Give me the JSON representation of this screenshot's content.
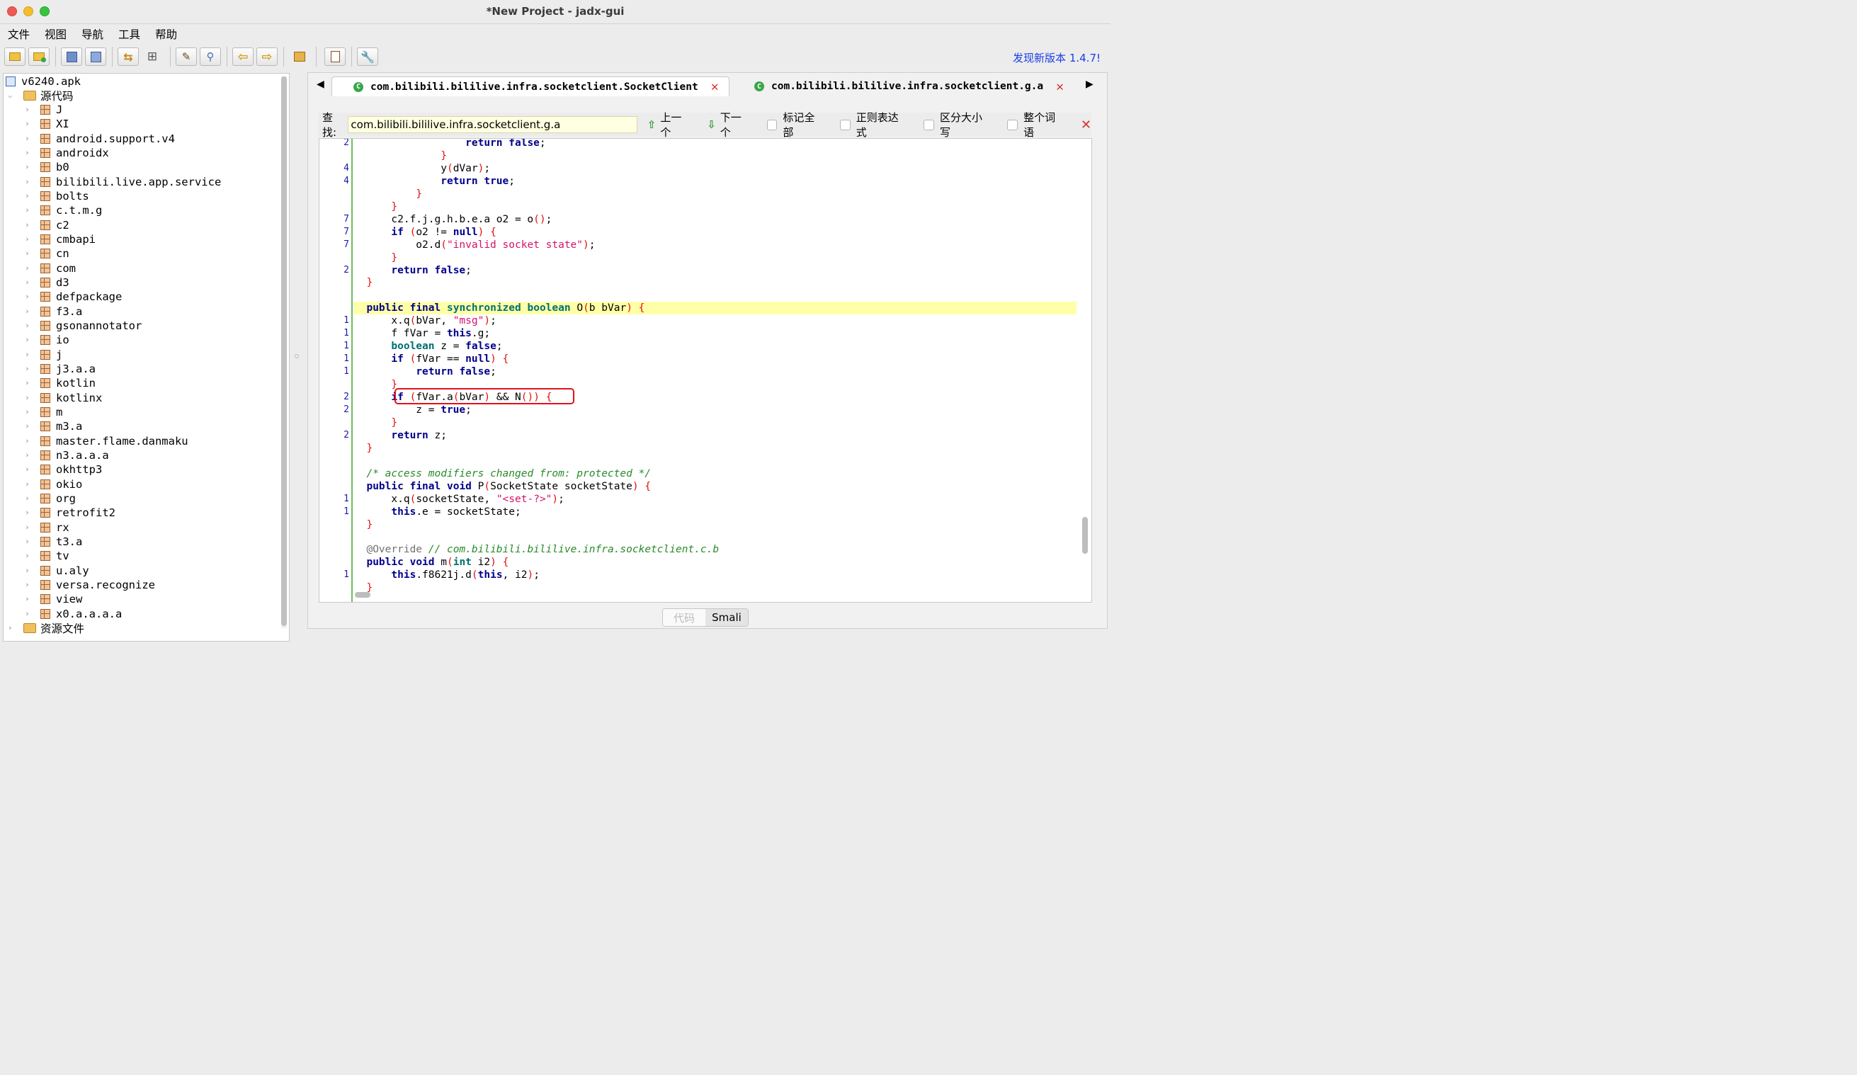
{
  "window": {
    "title": "*New Project - jadx-gui"
  },
  "menu": [
    "文件",
    "视图",
    "导航",
    "工具",
    "帮助"
  ],
  "toolbar": {
    "update_notice": "发现新版本 1.4.7!"
  },
  "tree": {
    "root": "v6240.apk",
    "source_folder": "源代码",
    "packages": [
      "J",
      "XI",
      "android.support.v4",
      "androidx",
      "b0",
      "bilibili.live.app.service",
      "bolts",
      "c.t.m.g",
      "c2",
      "cmbapi",
      "cn",
      "com",
      "d3",
      "defpackage",
      "f3.a",
      "gsonannotator",
      "io",
      "j",
      "j3.a.a",
      "kotlin",
      "kotlinx",
      "m",
      "m3.a",
      "master.flame.danmaku",
      "n3.a.a.a",
      "okhttp3",
      "okio",
      "org",
      "retrofit2",
      "rx",
      "t3.a",
      "tv",
      "u.aly",
      "versa.recognize",
      "view",
      "x0.a.a.a.a"
    ],
    "resources_folder": "资源文件"
  },
  "tabs": [
    {
      "label": "com.bilibili.bililive.infra.socketclient.SocketClient",
      "active": true
    },
    {
      "label": "com.bilibili.bililive.infra.socketclient.g.a",
      "active": false
    }
  ],
  "search": {
    "label": "查找:",
    "value": "com.bilibili.bililive.infra.socketclient.g.a",
    "prev": "上一个",
    "next": "下一个",
    "mark_all": "标记全部",
    "regex": "正则表达式",
    "case_sensitive": "区分大小写",
    "whole_word": "整个词语"
  },
  "code_lines": [
    {
      "n": "2",
      "html": "                <span class=\"kw\">return</span> <span class=\"kw\">false</span>;"
    },
    {
      "n": "",
      "html": "            <span class=\"br\">}</span>"
    },
    {
      "n": "4",
      "html": "            y<span class=\"br\">(</span>dVar<span class=\"br\">)</span>;"
    },
    {
      "n": "4",
      "html": "            <span class=\"kw\">return</span> <span class=\"kw\">true</span>;"
    },
    {
      "n": "",
      "html": "        <span class=\"br\">}</span>"
    },
    {
      "n": "",
      "html": "    <span class=\"br\">}</span>"
    },
    {
      "n": "7",
      "html": "    c2.f.j.g.h.b.e.a o2 = o<span class=\"br\">()</span>;"
    },
    {
      "n": "7",
      "html": "    <span class=\"kw\">if</span> <span class=\"br\">(</span>o2 != <span class=\"kw\">null</span><span class=\"br\">)</span> <span class=\"br\">{</span>"
    },
    {
      "n": "7",
      "html": "        o2.d<span class=\"br\">(</span><span class=\"str\">\"invalid socket state\"</span><span class=\"br\">)</span>;"
    },
    {
      "n": "",
      "html": "    <span class=\"br\">}</span>"
    },
    {
      "n": "2",
      "html": "    <span class=\"kw\">return</span> <span class=\"kw\">false</span>;"
    },
    {
      "n": "",
      "html": "<span class=\"br\">}</span>"
    },
    {
      "n": "",
      "html": ""
    },
    {
      "n": "",
      "html": "<span class=\"kw\">public</span> <span class=\"kw\">final</span> <span class=\"kt\">synchronized</span> <span class=\"kt\">boolean</span> O<span class=\"br\">(</span>b bVar<span class=\"br\">)</span> <span class=\"br\">{</span>",
      "hl": true
    },
    {
      "n": "1",
      "html": "    x.q<span class=\"br\">(</span>bVar, <span class=\"str\">\"msg\"</span><span class=\"br\">)</span>;"
    },
    {
      "n": "1",
      "html": "    f fVar = <span class=\"kw\">this</span>.g;"
    },
    {
      "n": "1",
      "html": "    <span class=\"kt\">boolean</span> z = <span class=\"kw\">false</span>;"
    },
    {
      "n": "1",
      "html": "    <span class=\"kw\">if</span> <span class=\"br\">(</span>fVar == <span class=\"kw\">null</span><span class=\"br\">)</span> <span class=\"br\">{</span>"
    },
    {
      "n": "1",
      "html": "        <span class=\"kw\">return</span> <span class=\"kw\">false</span>;"
    },
    {
      "n": "",
      "html": "    <span class=\"br\">}</span>"
    },
    {
      "n": "2",
      "html": "    <span class=\"kw\">if</span> <span class=\"br\">(</span>fVar.a<span class=\"br\">(</span>bVar<span class=\"br\">)</span> &amp;&amp; N<span class=\"br\">())</span> <span class=\"br\">{</span>"
    },
    {
      "n": "2",
      "html": "        z = <span class=\"kw\">true</span>;"
    },
    {
      "n": "",
      "html": "    <span class=\"br\">}</span>"
    },
    {
      "n": "2",
      "html": "    <span class=\"kw\">return</span> z;"
    },
    {
      "n": "",
      "html": "<span class=\"br\">}</span>"
    },
    {
      "n": "",
      "html": ""
    },
    {
      "n": "",
      "html": "<span class=\"cm\">/* access modifiers changed from: protected */</span>"
    },
    {
      "n": "",
      "html": "<span class=\"kw\">public</span> <span class=\"kw\">final</span> <span class=\"kw\">void</span> P<span class=\"br\">(</span>SocketState socketState<span class=\"br\">)</span> <span class=\"br\">{</span>"
    },
    {
      "n": "1",
      "html": "    x.q<span class=\"br\">(</span>socketState, <span class=\"str\">\"&lt;set-?&gt;\"</span><span class=\"br\">)</span>;"
    },
    {
      "n": "1",
      "html": "    <span class=\"kw\">this</span>.e = socketState;"
    },
    {
      "n": "",
      "html": "<span class=\"br\">}</span>"
    },
    {
      "n": "",
      "html": ""
    },
    {
      "n": "",
      "html": "<span class=\"an\">@Override</span> <span class=\"cm\">// com.bilibili.bililive.infra.socketclient.c.b</span>"
    },
    {
      "n": "",
      "html": "<span class=\"kw\">public</span> <span class=\"kw\">void</span> m<span class=\"br\">(</span><span class=\"kt\">int</span> i2<span class=\"br\">)</span> <span class=\"br\">{</span>"
    },
    {
      "n": "1",
      "html": "    <span class=\"kw\">this</span>.f8621j.d<span class=\"br\">(</span><span class=\"kw\">this</span>, i2<span class=\"br\">)</span>;"
    },
    {
      "n": "",
      "html": "<span class=\"br\">}</span>"
    }
  ],
  "bottom_tabs": {
    "code": "代码",
    "smali": "Smali"
  }
}
